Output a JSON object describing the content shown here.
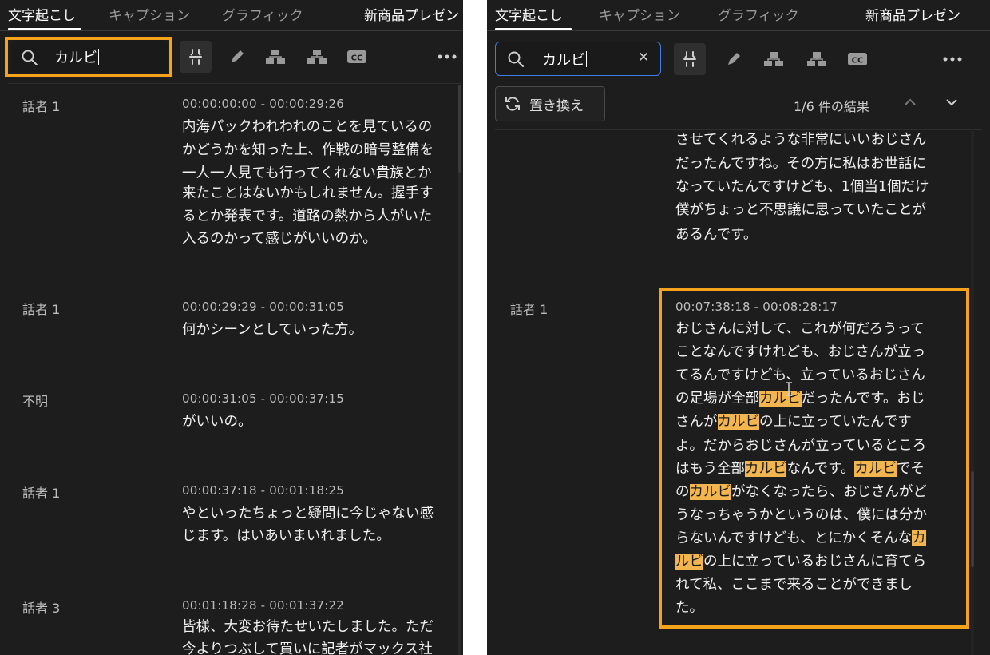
{
  "tabs": [
    "文字起こし",
    "キャプション",
    "グラフィック"
  ],
  "project_title": "新商品プレゼン",
  "search": {
    "query": "カルビ",
    "results": "1/6 件の結果",
    "replace_label": "置き換え"
  },
  "left_entries": [
    {
      "speaker": "話者 1",
      "timecode": "00:00:00:00 - 00:00:29:26",
      "lines": [
        "内海パックわれわれのことを見ているの",
        "かどうかを知った上、作戦の暗号整備を",
        "一人一人見ても行ってくれない貴族とか",
        "来たことはないかもしれません。握手す",
        "るとか発表です。道路の熱から人がいた",
        "入るのかって感じがいいのか。"
      ]
    },
    {
      "speaker": "話者 1",
      "timecode": "00:00:29:29 - 00:00:31:05",
      "lines": [
        "何かシーンとしていった方。"
      ]
    },
    {
      "speaker": "不明",
      "timecode": "00:00:31:05 - 00:00:37:15",
      "lines": [
        "がいいの。"
      ]
    },
    {
      "speaker": "話者 1",
      "timecode": "00:00:37:18 - 00:01:18:25",
      "lines": [
        "やといったちょっと疑問に今じゃない感",
        "じます。はいあいまいれました。"
      ]
    },
    {
      "speaker": "話者 3",
      "timecode": "00:01:18:28 - 00:01:37:22",
      "lines": [
        "皆様、大変お待たせいたしました。ただ",
        "今よりつぶして買いに記者がマックス社"
      ]
    }
  ],
  "right_prev_lines": [
    "させてくれるような非常にいいおじさん",
    "だったんですね。その方に私はお世話に",
    "なっていたんですけども、1個当1個だけ",
    "僕がちょっと不思議に思っていたことが",
    "あるんです。"
  ],
  "right_entry": {
    "speaker": "話者 1",
    "timecode": "00:07:38:18 - 00:08:28:17",
    "lines": [
      [
        {
          "t": "おじさんに対して、これが何だろうって"
        }
      ],
      [
        {
          "t": "ことなんですけれども、おじさんが立っ"
        }
      ],
      [
        {
          "t": "てるんですけども、立っているおじさん"
        }
      ],
      [
        {
          "t": "の足場が全部"
        },
        {
          "t": "カルビ",
          "h": true
        },
        {
          "t": "だったんです。おじ"
        }
      ],
      [
        {
          "t": "さんが"
        },
        {
          "t": "カルビ",
          "h": true
        },
        {
          "t": "の上に立っていたんです"
        }
      ],
      [
        {
          "t": "よ。だからおじさんが立っているところ"
        }
      ],
      [
        {
          "t": "はもう全部"
        },
        {
          "t": "カルビ",
          "h": true
        },
        {
          "t": "なんです。"
        },
        {
          "t": "カルビ",
          "h": true
        },
        {
          "t": "でそ"
        }
      ],
      [
        {
          "t": "の"
        },
        {
          "t": "カルビ",
          "h": true
        },
        {
          "t": "がなくなったら、おじさんがど"
        }
      ],
      [
        {
          "t": "うなっちゃうかというのは、僕には分か"
        }
      ],
      [
        {
          "t": "らないんですけども、とにかくそんな"
        },
        {
          "t": "カ",
          "h": true
        }
      ],
      [
        {
          "t": "ルビ",
          "h": true
        },
        {
          "t": "の上に立っているおじさんに育てら"
        }
      ],
      [
        {
          "t": "れて私、ここまで来ることができまし"
        }
      ],
      [
        {
          "t": "た。"
        }
      ]
    ]
  },
  "colors": {
    "panel_bg": "#1d1d1d",
    "accent_frame": "#f7a21b",
    "match_highlight": "#f3b64f"
  }
}
